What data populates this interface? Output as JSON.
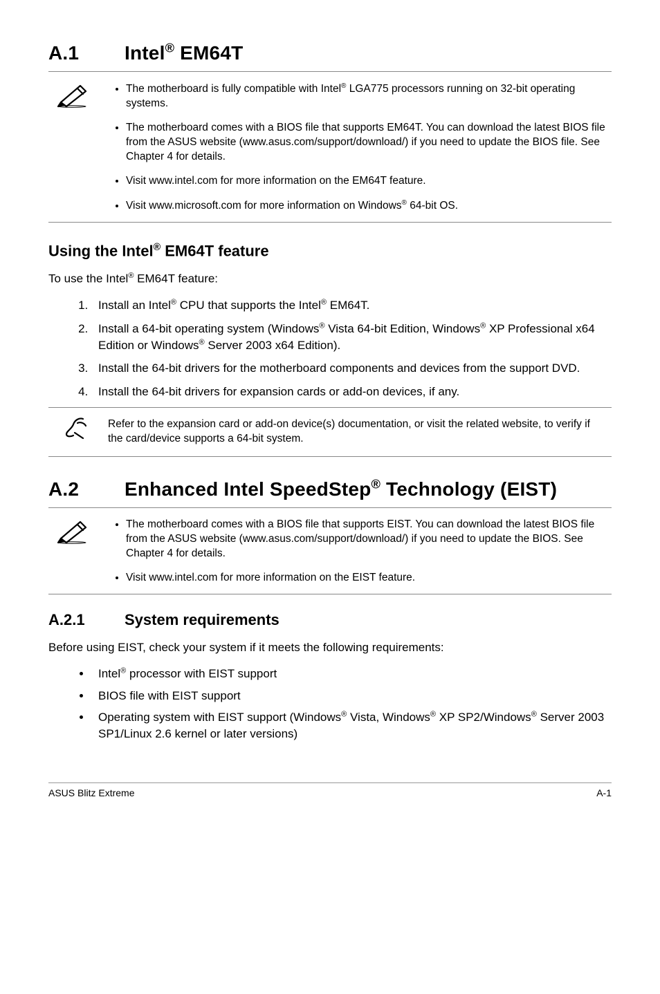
{
  "sectionA1": {
    "num": "A.1",
    "titleHtml": "Intel<sup>®</sup> EM64T"
  },
  "noteA1": {
    "items": [
      "The motherboard is fully compatible with Intel<sup>®</sup> LGA775 processors running on 32-bit operating systems.",
      "The motherboard comes with a BIOS file that supports EM64T. You can download the latest BIOS file from the ASUS website (www.asus.com/support/download/) if you need to update the BIOS file. See Chapter 4 for details.",
      "Visit www.intel.com for more information on the EM64T feature.",
      "Visit www.microsoft.com for more information on Windows<sup>®</sup> 64-bit OS."
    ]
  },
  "usingHeadingHtml": "Using the Intel<sup>®</sup> EM64T feature",
  "usingIntroHtml": "To use the Intel<sup>®</sup> EM64T feature:",
  "usingSteps": [
    "Install an Intel<sup>®</sup> CPU that supports the Intel<sup>®</sup> EM64T.",
    "Install a 64-bit operating system (Windows<sup>®</sup> Vista 64-bit Edition, Windows<sup>®</sup> XP Professional x64 Edition or Windows<sup>®</sup> Server 2003 x64 Edition).",
    "Install the 64-bit drivers for the motherboard components and devices from the support DVD.",
    "Install the 64-bit drivers for expansion cards or add-on devices, if any."
  ],
  "noteRefer": "Refer to the expansion card or add-on device(s) documentation, or visit the related website, to verify if the card/device supports a 64-bit system.",
  "sectionA2": {
    "num": "A.2",
    "titleHtml": "Enhanced Intel SpeedStep<sup>®</sup> Technology (EIST)"
  },
  "noteA2": {
    "items": [
      "The motherboard comes with a BIOS file that supports EIST. You can download the latest BIOS file from the ASUS website (www.asus.com/support/download/) if you need to update the BIOS. See Chapter 4 for details.",
      "Visit www.intel.com for more information on the EIST feature."
    ]
  },
  "sectionA21": {
    "num": "A.2.1",
    "title": "System requirements"
  },
  "reqIntro": "Before using EIST, check your system if it meets the following requirements:",
  "reqItems": [
    "Intel<sup>®</sup> processor with EIST support",
    "BIOS file with EIST support",
    "Operating system with EIST support (Windows<sup>®</sup> Vista, Windows<sup>®</sup> XP SP2/Windows<sup>®</sup> Server 2003 SP1/Linux 2.6 kernel or later versions)"
  ],
  "footer": {
    "left": "ASUS Blitz Extreme",
    "right": "A-1"
  },
  "icons": {
    "pencil": "pencil-icon",
    "info": "info-icon"
  }
}
